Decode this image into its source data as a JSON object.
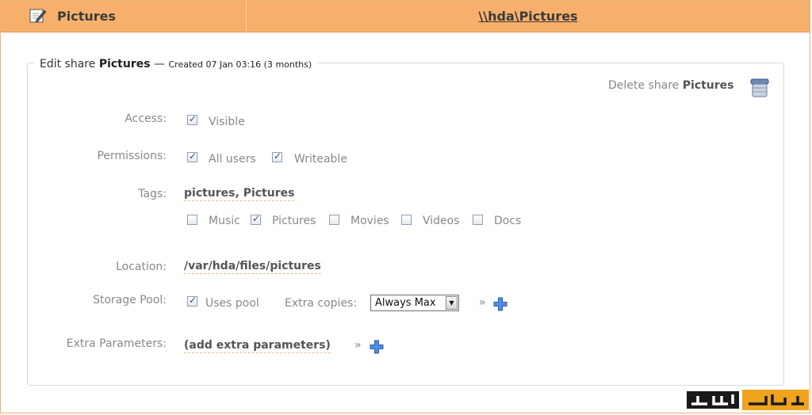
{
  "header": {
    "title": "Pictures",
    "path": "\\\\hda\\Pictures"
  },
  "fieldset": {
    "legend_prefix": "Edit share ",
    "legend_name": "Pictures",
    "legend_dash": " — ",
    "created": "Created 07 Jan 03:16 (3 months)"
  },
  "delete": {
    "prefix": "Delete share ",
    "name": "Pictures"
  },
  "access": {
    "label": "Access:",
    "visible_label": "Visible",
    "visible_checked": true
  },
  "permissions": {
    "label": "Permissions:",
    "all_users_label": "All users",
    "all_users_checked": true,
    "writeable_label": "Writeable",
    "writeable_checked": true
  },
  "tags": {
    "label": "Tags:",
    "value": "pictures, Pictures",
    "options": [
      {
        "label": "Music",
        "checked": false
      },
      {
        "label": "Pictures",
        "checked": true
      },
      {
        "label": "Movies",
        "checked": false
      },
      {
        "label": "Videos",
        "checked": false
      },
      {
        "label": "Docs",
        "checked": false
      }
    ]
  },
  "location": {
    "label": "Location:",
    "value": "/var/hda/files/pictures"
  },
  "storage_pool": {
    "label": "Storage Pool:",
    "uses_pool_label": "Uses pool",
    "uses_pool_checked": true,
    "extra_copies_label": "Extra copies:",
    "extra_copies_value": "Always Max",
    "more": "»"
  },
  "extra_params": {
    "label": "Extra Parameters:",
    "value": "(add extra parameters)",
    "more": "»"
  },
  "colors": {
    "header_bg": "#f6b06c",
    "panel_border": "#d4dbe6",
    "plus_blue": "#3f7fd8"
  }
}
